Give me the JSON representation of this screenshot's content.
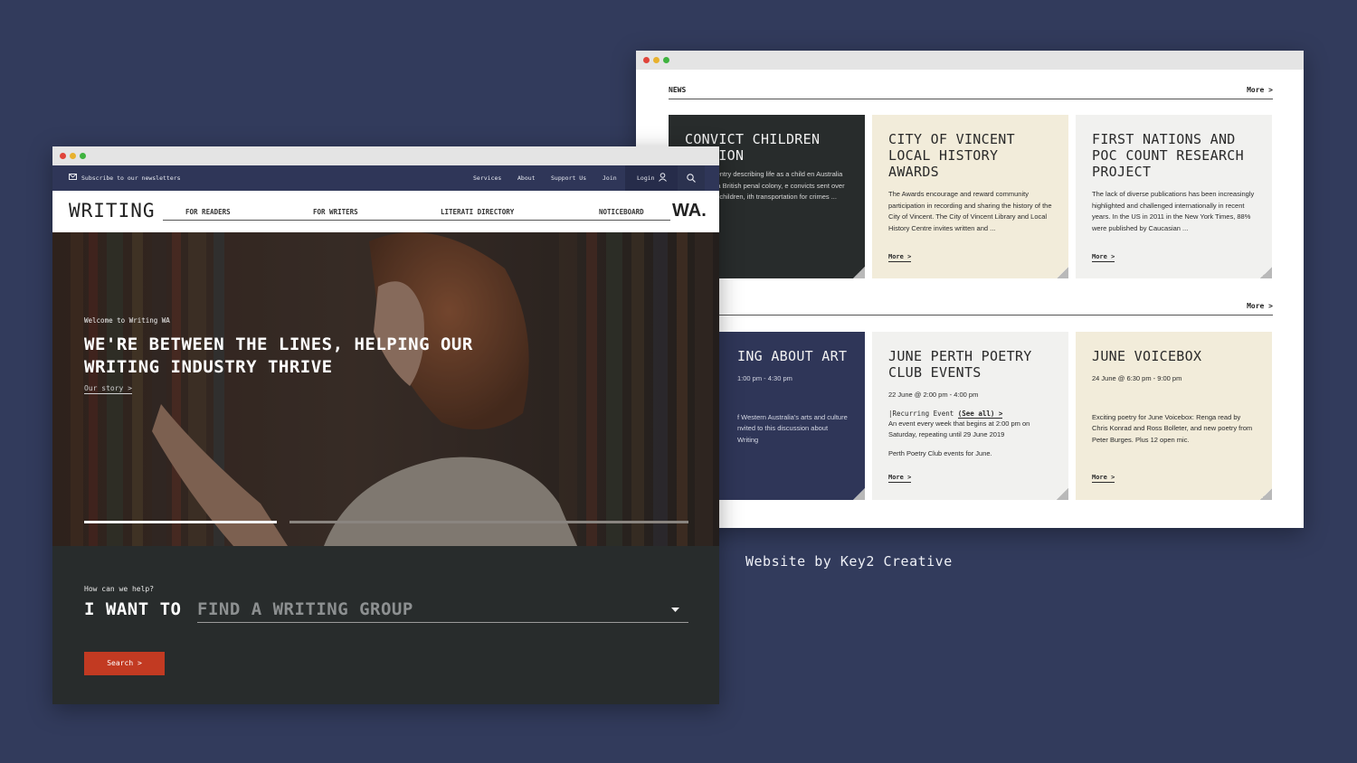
{
  "credit": "Website by Key2 Creative",
  "colors": {
    "background": "#323b5c",
    "navy": "#2f3658",
    "charcoal": "#282c2c",
    "cream": "#f2ecda",
    "light_grey": "#f1f1ef",
    "accent_red": "#c23a22"
  },
  "news_window": {
    "section1": {
      "label": "NEWS",
      "more": "More >"
    },
    "cards_row1": [
      {
        "title": "CONVICT CHILDREN ETITION",
        "body": "rnal entry describing life as a child en Australia was a British penal colony, e convicts sent over were children, ith transportation for crimes ..."
      },
      {
        "title": "CITY OF VINCENT LOCAL HISTORY AWARDS",
        "body": "The Awards encourage and reward community participation in recording and sharing the history of the City of Vincent. The City of Vincent Library and Local History Centre invites written and ...",
        "more": "More >"
      },
      {
        "title": "FIRST NATIONS AND POC COUNT RESEARCH PROJECT",
        "body": "The lack of diverse publications has been increasingly highlighted and challenged internationally in recent years. In the US in 2011 in the New York Times, 88% were published by Caucasian ...",
        "more": "More >"
      }
    ],
    "section2": {
      "more": "More >"
    },
    "cards_row2": [
      {
        "title": "ING ABOUT ART",
        "date": "1:00 pm - 4:30 pm",
        "body": "f Western Australia's arts and culture nvited to this discussion about Writing"
      },
      {
        "title": "JUNE PERTH POETRY CLUB EVENTS",
        "date": "22 June @ 2:00 pm - 4:00 pm",
        "recurring": "|Recurring Event",
        "see_all": "(See all) >",
        "body": "An event every week that begins at 2:00 pm on Saturday, repeating until 29 June 2019",
        "body2": "Perth Poetry Club events for June.",
        "more": "More >"
      },
      {
        "title": "JUNE VOICEBOX",
        "date": "24 June @ 6:30 pm - 9:00 pm",
        "body": "Exciting poetry for June Voicebox: Renga read by Chris Konrad and Ross Bolleter, and new poetry from Peter Burges. Plus 12 open mic.",
        "more": "More >"
      }
    ]
  },
  "home_window": {
    "topbar": {
      "subscribe": "Subscribe to our newsletters",
      "links": [
        "Services",
        "About",
        "Support Us",
        "Join"
      ],
      "login": "Login"
    },
    "logo_left": "WRITING",
    "logo_right": "WA.",
    "nav": [
      "FOR READERS",
      "FOR WRITERS",
      "LITERATI DIRECTORY",
      "NOTICEBOARD"
    ],
    "hero": {
      "eyebrow": "Welcome to Writing WA",
      "headline_1": "WE'RE BETWEEN THE LINES, HELPING OUR",
      "headline_2": "WRITING INDUSTRY THRIVE",
      "link": "Our story >",
      "slider_position": 1,
      "slider_count": 2
    },
    "helper": {
      "question": "How can we help?",
      "prefix": "I WANT TO",
      "selected": "FIND A WRITING GROUP",
      "button": "Search >"
    }
  }
}
